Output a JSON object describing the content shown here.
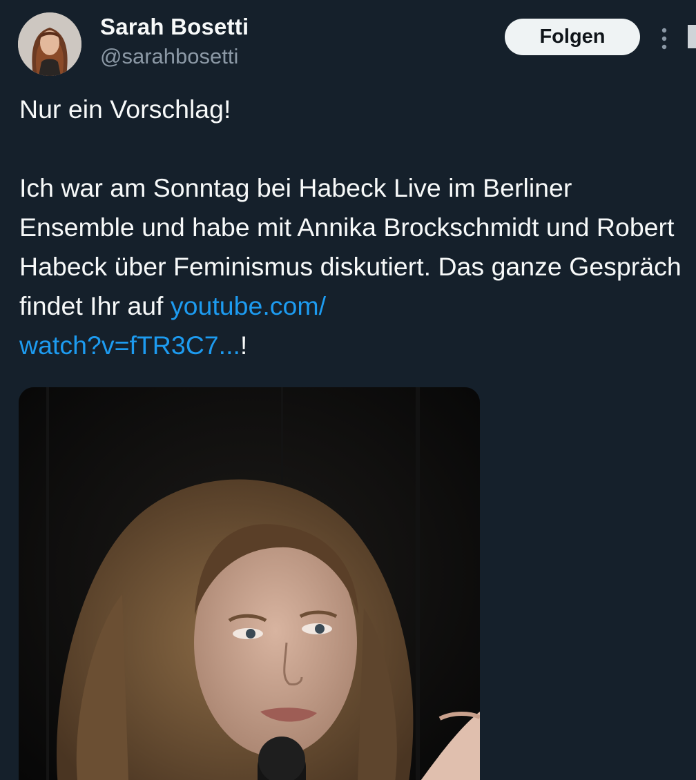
{
  "author": {
    "display_name": "Sarah Bosetti",
    "handle": "@sarahbosetti",
    "avatar_icon": "profile-photo"
  },
  "actions": {
    "follow_label": "Folgen",
    "more_icon": "more-vertical-icon"
  },
  "tweet": {
    "line1": "Nur ein Vorschlag!",
    "body_text": "Ich war am Sonntag bei Habeck Live im Berliner Ensemble und habe mit Annika Brockschmidt und Robert Habeck über Feminismus diskutiert. Das ganze Gespräch findet Ihr auf",
    "link_part1": "youtube.com/",
    "link_part2": "watch?v=fTR3C7...",
    "trailing": "!"
  },
  "media": {
    "description_icon": "photo-woman-with-microphone"
  },
  "colors": {
    "background": "#15202b",
    "text": "#f7f9f9",
    "secondary_text": "#8b98a5",
    "link": "#1d9bf0",
    "follow_button_bg": "#eff3f4",
    "follow_button_text": "#0f1419"
  }
}
